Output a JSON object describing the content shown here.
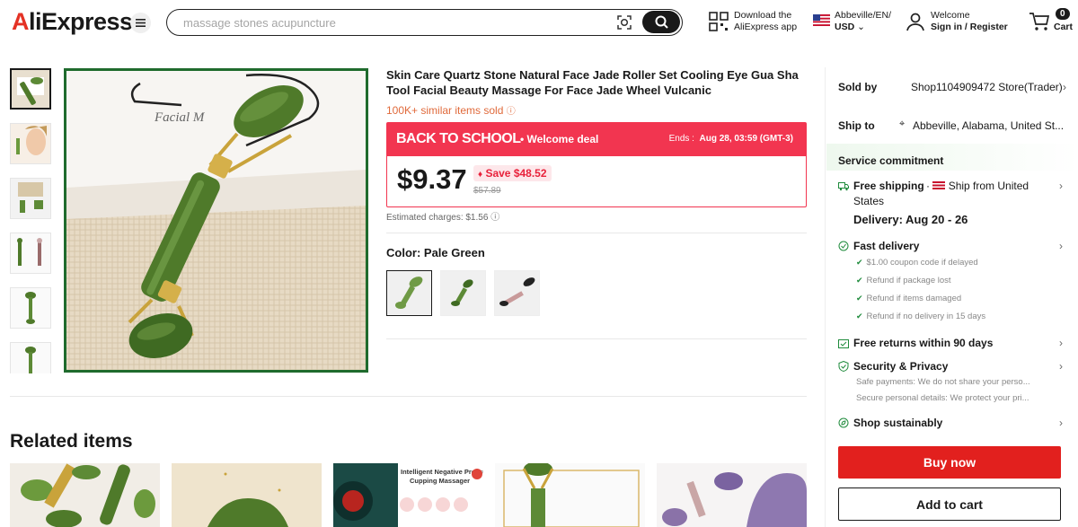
{
  "header": {
    "logo": "AliExpress",
    "search_placeholder": "massage stones acupuncture",
    "download_line1": "Download the",
    "download_line2": "AliExpress app",
    "locale_line1": "Abbeville/EN/",
    "locale_line2": "USD",
    "account_line1": "Welcome",
    "account_line2": "Sign in / Register",
    "cart_count": "0",
    "cart_label": "Cart"
  },
  "product": {
    "title": "Skin Care Quartz Stone Natural Face Jade Roller Set Cooling Eye Gua Sha Tool Facial Beauty Massage For Face Jade Wheel Vulcanic",
    "sold": "100K+ similar items sold",
    "deal_banner": "BACK TO SCHOOL",
    "deal_sub": "• Welcome deal",
    "ends_label": "Ends :",
    "ends_value": "Aug 28, 03:59 (GMT-3)",
    "price": "$9.37",
    "save": "Save $48.52",
    "original_price": "$57.89",
    "estimated_charges": "Estimated charges: $1.56",
    "color_label": "Color:",
    "color_value": "Pale Green"
  },
  "panel": {
    "sold_by_label": "Sold by",
    "sold_by_value": "Shop1104909472 Store(Trader)",
    "ship_to_label": "Ship to",
    "ship_to_value": "Abbeville, Alabama, United St...",
    "service_commitment": "Service commitment",
    "free_shipping": "Free shipping",
    "ship_from": "Ship from United",
    "ship_from_cont": "States",
    "delivery": "Delivery: Aug 20 - 26",
    "fast_delivery": "Fast delivery",
    "fast_items": [
      "$1.00 coupon code if delayed",
      "Refund if package lost",
      "Refund if items damaged",
      "Refund if no delivery in 15 days"
    ],
    "free_returns": "Free returns within 90 days",
    "security": "Security & Privacy",
    "security_sub1": "Safe payments: We do not share your perso...",
    "security_sub2": "Secure personal details: We protect your pri...",
    "shop_sustainably": "Shop sustainably",
    "buy_now": "Buy now",
    "add_to_cart": "Add to cart"
  },
  "related": {
    "title": "Related items",
    "item3_text_line1": "Intelligent Negative Pressure",
    "item3_text_line2": "Cupping Massager"
  },
  "colors": {
    "accent_red": "#f23550",
    "buy_red": "#e2201e",
    "jade_green": "#4f7a2a"
  }
}
